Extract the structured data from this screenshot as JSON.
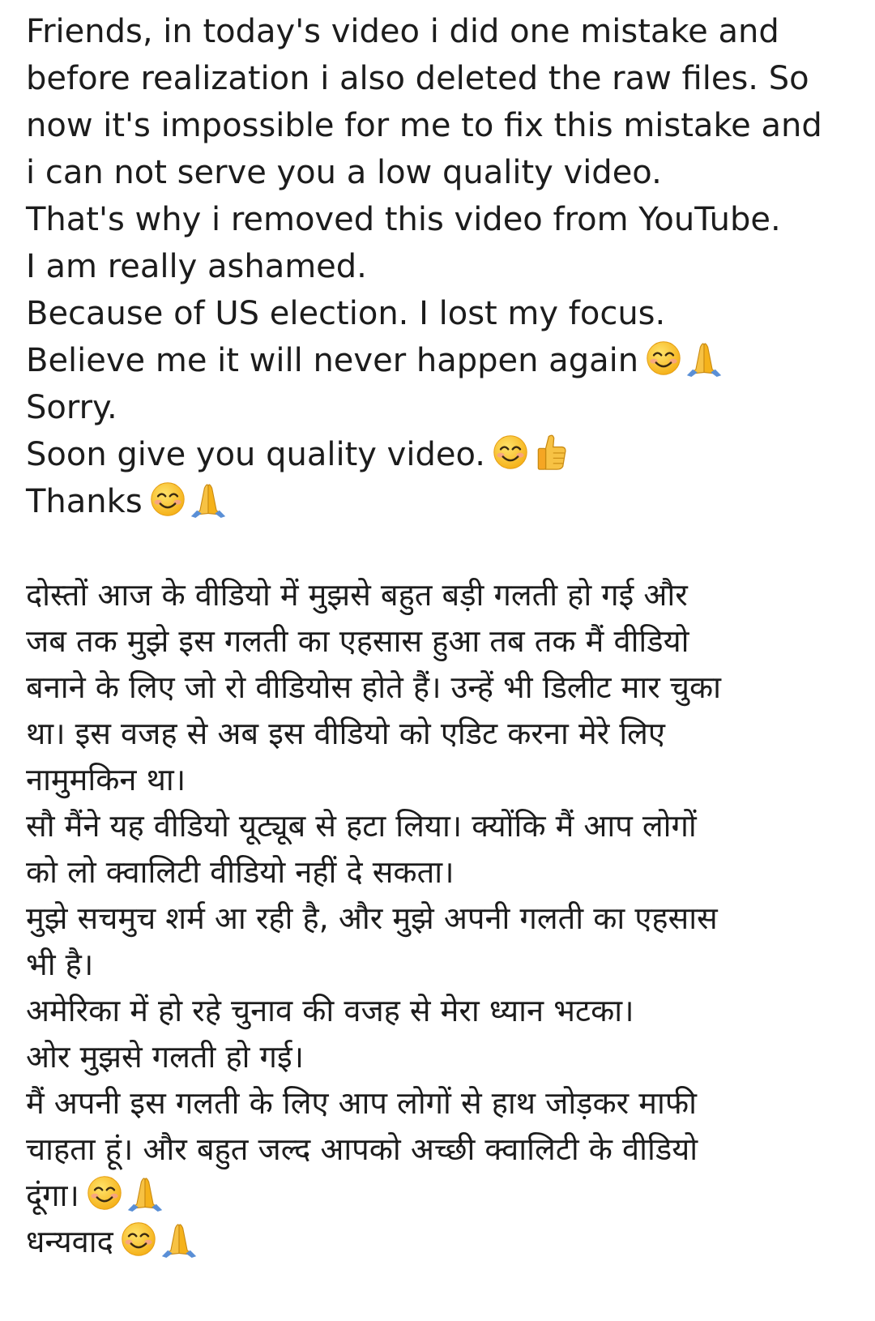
{
  "post": {
    "english_lines": [
      {
        "text": "Friends, in today's video i did one mistake and",
        "emojis": []
      },
      {
        "text": "before realization i also deleted the raw files. So",
        "emojis": []
      },
      {
        "text": "now it's impossible for me to fix this mistake and",
        "emojis": []
      },
      {
        "text": "i can not serve you a low quality video.",
        "emojis": []
      },
      {
        "text": "That's why i removed this video from YouTube.",
        "emojis": []
      },
      {
        "text": "I am really ashamed.",
        "emojis": []
      },
      {
        "text": "Because of US election. I lost my focus.",
        "emojis": []
      },
      {
        "text": "Believe me it will never happen again",
        "emojis": [
          "smiling-face",
          "folded-hands"
        ]
      },
      {
        "text": "Sorry.",
        "emojis": []
      },
      {
        "text": "Soon give you quality video.",
        "emojis": [
          "smiling-face",
          "thumbs-up"
        ]
      },
      {
        "text": "Thanks",
        "emojis": [
          "smiling-face",
          "folded-hands"
        ]
      }
    ],
    "hindi_lines": [
      {
        "text": "दोस्तों आज के वीडियो में मुझसे बहुत बड़ी गलती हो गई और",
        "emojis": []
      },
      {
        "text": "जब तक मुझे इस गलती का एहसास हुआ तब तक मैं वीडियो",
        "emojis": []
      },
      {
        "text": "बनाने के लिए जो रो वीडियोस होते हैं। उन्हें भी डिलीट मार चुका",
        "emojis": []
      },
      {
        "text": "था। इस वजह से अब इस वीडियो को एडिट करना मेरे लिए",
        "emojis": []
      },
      {
        "text": "नामुमकिन था।",
        "emojis": []
      },
      {
        "text": "सौ मैंने यह वीडियो यूट्यूब से हटा लिया। क्योंकि मैं आप लोगों",
        "emojis": []
      },
      {
        "text": "को लो क्वालिटी वीडियो नहीं दे सकता।",
        "emojis": []
      },
      {
        "text": "मुझे सचमुच शर्म आ रही है, और मुझे अपनी गलती का एहसास",
        "emojis": []
      },
      {
        "text": "भी है।",
        "emojis": []
      },
      {
        "text": "अमेरिका में हो रहे चुनाव की वजह से मेरा ध्यान भटका।",
        "emojis": []
      },
      {
        "text": "ओर मुझसे गलती हो गई।",
        "emojis": []
      },
      {
        "text": "मैं अपनी इस गलती के लिए आप लोगों से हाथ जोड़कर माफी",
        "emojis": []
      },
      {
        "text": "चाहता हूं। और बहुत जल्द आपको अच्छी क्वालिटी के वीडियो",
        "emojis": []
      },
      {
        "text": "दूंगा।",
        "emojis": [
          "smiling-face",
          "folded-hands"
        ]
      },
      {
        "text": "धन्यवाद",
        "emojis": [
          "smiling-face",
          "folded-hands"
        ]
      }
    ]
  },
  "colors": {
    "text": "#1c1c1c",
    "background": "#ffffff",
    "emoji_yellow": "#fcc21b",
    "emoji_orange": "#f5a623",
    "emoji_blush": "#f7a08a",
    "hands_blue": "#5a8fd6"
  }
}
